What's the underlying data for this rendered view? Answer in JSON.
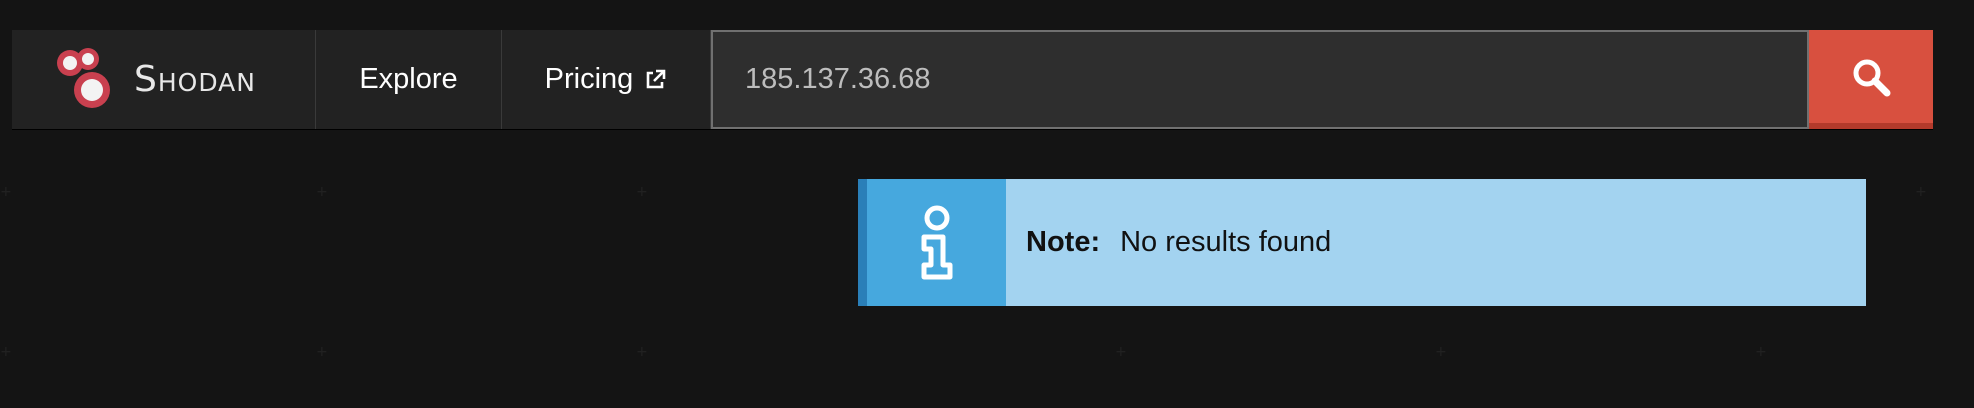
{
  "brand": {
    "name": "Shodan"
  },
  "nav": {
    "explore_label": "Explore",
    "pricing_label": "Pricing"
  },
  "search": {
    "value": "185.137.36.68"
  },
  "alert": {
    "label": "Note:",
    "message": "No results found"
  },
  "colors": {
    "background": "#141414",
    "navbar": "#222222",
    "search_button": "#d8503f",
    "alert_bg": "#a3d3f0",
    "alert_icon_bg": "#46a8de",
    "logo_red": "#c9404f"
  },
  "icons": {
    "logo": "shodan-logo-icon",
    "external": "external-link-icon",
    "search": "search-icon",
    "info": "info-icon"
  }
}
